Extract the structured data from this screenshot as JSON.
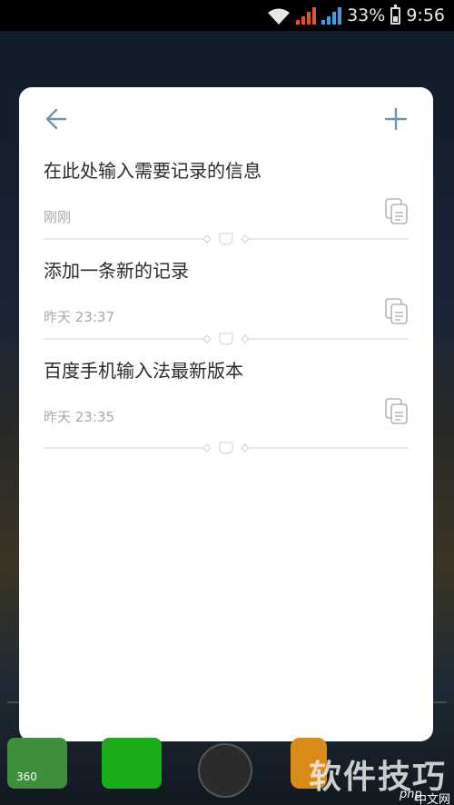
{
  "status_bar": {
    "battery_percent": "33%",
    "time": "9:56"
  },
  "header": {
    "back_icon": "arrow-left-icon",
    "add_icon": "plus-icon"
  },
  "notes": [
    {
      "title": "在此处输入需要记录的信息",
      "time": "刚刚"
    },
    {
      "title": "添加一条新的记录",
      "time": "昨天 23:37"
    },
    {
      "title": "百度手机输入法最新版本",
      "time": "昨天 23:35"
    }
  ],
  "watermark": {
    "big": "软件技巧",
    "small": "中文网",
    "php": "php"
  },
  "dock": {
    "phone_label": "360"
  },
  "colors": {
    "accent": "#6a95b7",
    "divider": "#c9d3dd",
    "title_text": "#2b2b2b",
    "time_text": "#a9a9a9"
  }
}
